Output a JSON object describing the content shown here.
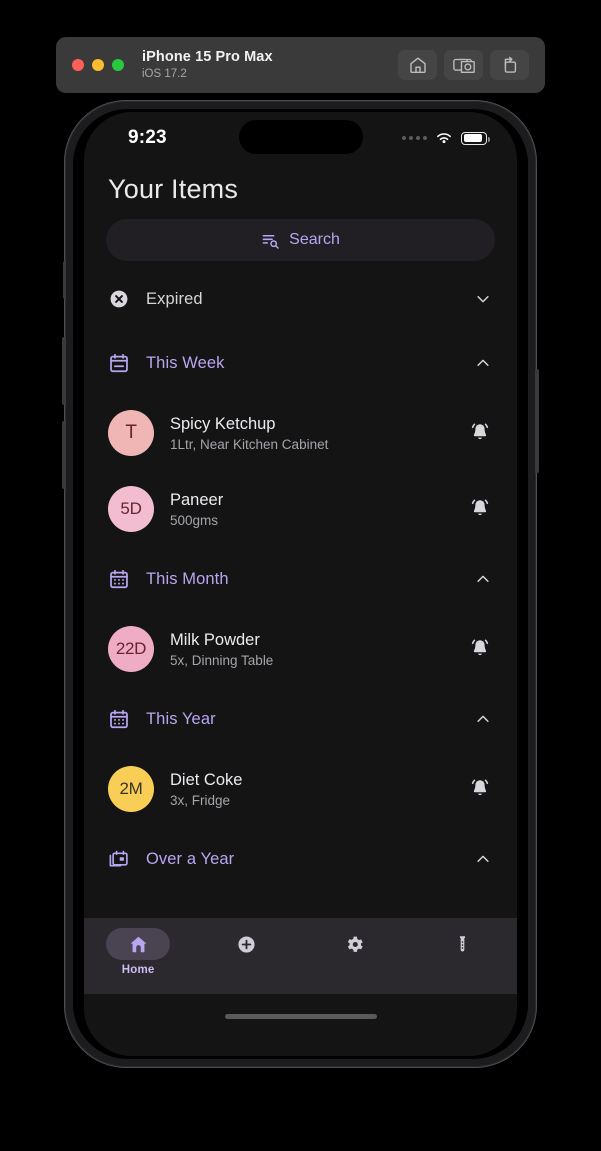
{
  "simulator": {
    "device": "iPhone 15 Pro Max",
    "os": "iOS 17.2",
    "traffic_lights": [
      "close-red",
      "minimize-yellow",
      "maximize-green"
    ],
    "actions": [
      {
        "name": "home-icon",
        "label": "Home"
      },
      {
        "name": "screenshot-icon",
        "label": "Screenshot"
      },
      {
        "name": "rotate-icon",
        "label": "Rotate"
      }
    ],
    "colors": {
      "titlebar": "#3a3a3a",
      "button": "#454545"
    }
  },
  "status_bar": {
    "time": "9:23",
    "cellular_icon": "cellular-dots-icon",
    "wifi_icon": "wifi-icon",
    "battery_icon": "battery-icon"
  },
  "app": {
    "title": "Your Items",
    "search": {
      "label": "Search",
      "icon": "manage-search-icon"
    },
    "colors": {
      "accent": "#b9a6f0",
      "background": "#141414",
      "tabbar": "#2b282e",
      "avatar_pink": "#f0b5b5",
      "avatar_pink_light": "#f2bdd1",
      "avatar_yellow": "#f9ce57"
    },
    "sections": [
      {
        "id": "expired",
        "label": "Expired",
        "icon": "cancel-circle-icon",
        "label_style": "muted",
        "expanded": false,
        "chevron": "chevron-down-icon",
        "items": []
      },
      {
        "id": "this-week",
        "label": "This Week",
        "icon": "calendar-today-icon",
        "label_style": "accent",
        "expanded": true,
        "chevron": "chevron-up-icon",
        "items": [
          {
            "badge": "T",
            "badge_color": "#f0b5b5",
            "badge_text_color": "#6a2430",
            "title": "Spicy Ketchup",
            "subtitle": "1Ltr, Near Kitchen Cabinet",
            "bell": "notification-active-icon"
          },
          {
            "badge": "5D",
            "badge_color": "#f2bdd1",
            "badge_text_color": "#6a2430",
            "title": "Paneer",
            "subtitle": "500gms",
            "bell": "notification-active-icon"
          }
        ]
      },
      {
        "id": "this-month",
        "label": "This Month",
        "icon": "calendar-month-icon",
        "label_style": "accent",
        "expanded": true,
        "chevron": "chevron-up-icon",
        "items": [
          {
            "badge": "22D",
            "badge_color": "#eeacc5",
            "badge_text_color": "#6a2430",
            "title": "Milk Powder",
            "subtitle": "5x, Dinning Table",
            "bell": "notification-active-icon"
          }
        ]
      },
      {
        "id": "this-year",
        "label": "This Year",
        "icon": "calendar-month-icon",
        "label_style": "accent",
        "expanded": true,
        "chevron": "chevron-up-icon",
        "items": [
          {
            "badge": "2M",
            "badge_color": "#f9ce57",
            "badge_text_color": "#3a3320",
            "title": "Diet Coke",
            "subtitle": "3x, Fridge",
            "bell": "notification-active-icon"
          }
        ]
      },
      {
        "id": "over-a-year",
        "label": "Over a Year",
        "icon": "calendar-stack-icon",
        "label_style": "accent",
        "expanded": true,
        "chevron": "chevron-up-icon",
        "items": []
      }
    ],
    "tabs": [
      {
        "id": "home",
        "icon": "home-icon",
        "label": "Home",
        "active": true
      },
      {
        "id": "add",
        "icon": "add-circle-icon",
        "label": "",
        "active": false
      },
      {
        "id": "settings",
        "icon": "gear-icon",
        "label": "",
        "active": false
      },
      {
        "id": "science",
        "icon": "test-tube-icon",
        "label": "",
        "active": false
      }
    ]
  }
}
